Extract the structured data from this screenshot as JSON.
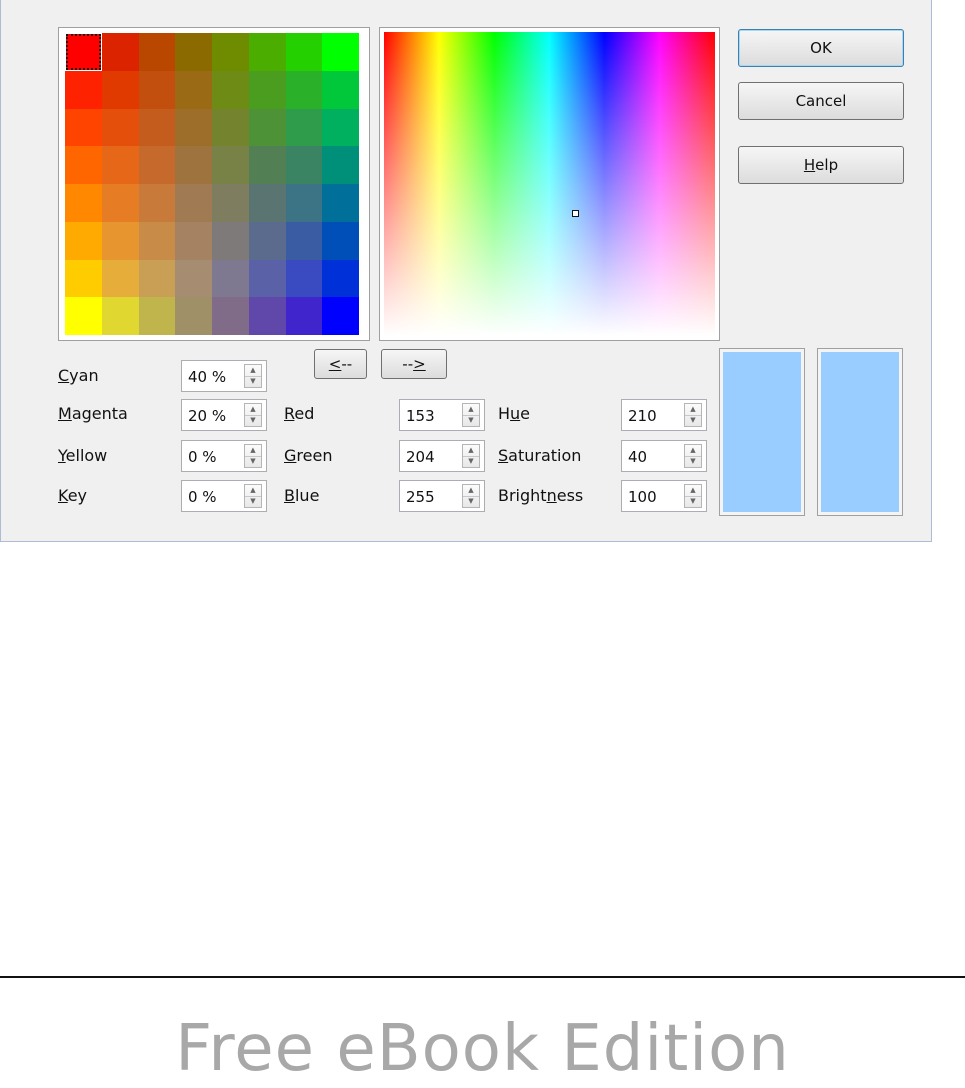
{
  "palette": {
    "rows": [
      [
        "#ff0000",
        "#dc2300",
        "#b94700",
        "#8b6b00",
        "#6f8b00",
        "#4aad00",
        "#25d000",
        "#00ff00"
      ],
      [
        "#ff2200",
        "#e03a00",
        "#c24f0e",
        "#9a6a15",
        "#6e8b16",
        "#4a9d1f",
        "#2bb02a",
        "#00c83a"
      ],
      [
        "#ff4400",
        "#e4500c",
        "#c45c1d",
        "#9c6e2a",
        "#74842e",
        "#4e9238",
        "#2e9c4a",
        "#00b05e"
      ],
      [
        "#ff6600",
        "#e66718",
        "#c6692c",
        "#9e733e",
        "#788146",
        "#537f55",
        "#3a8464",
        "#00907a"
      ],
      [
        "#ff8800",
        "#e67d24",
        "#c87a3b",
        "#a07a52",
        "#7e7d60",
        "#5a7472",
        "#3c7485",
        "#00709a"
      ],
      [
        "#ffaa00",
        "#e6952f",
        "#c98b48",
        "#a48262",
        "#7e7a7a",
        "#5a6b8e",
        "#3a5ca2",
        "#004fb8"
      ],
      [
        "#ffcc00",
        "#e6ad3a",
        "#c99e55",
        "#a68d72",
        "#7e7890",
        "#5a61a6",
        "#3a4ac0",
        "#0030d8"
      ],
      [
        "#ffff00",
        "#e0d830",
        "#c0b44d",
        "#a09068",
        "#806c88",
        "#6048aa",
        "#4024cc",
        "#0000ff"
      ]
    ]
  },
  "buttons": {
    "ok": "OK",
    "cancel": "Cancel",
    "help_pre": "",
    "help_ul": "H",
    "help_post": "elp",
    "left_ul": "<",
    "left_post": "--",
    "right_pre": "--",
    "right_ul": ">"
  },
  "cmyk": {
    "cyan": {
      "ul": "C",
      "rest": "yan",
      "value": "40 %"
    },
    "magenta": {
      "ul": "M",
      "rest": "agenta",
      "value": "20 %"
    },
    "yellow": {
      "ul": "Y",
      "rest": "ellow",
      "value": "0 %"
    },
    "key": {
      "ul": "K",
      "rest": "ey",
      "value": "0 %"
    }
  },
  "rgb": {
    "red": {
      "ul": "R",
      "rest": "ed",
      "value": "153"
    },
    "green": {
      "ul": "G",
      "rest": "reen",
      "value": "204"
    },
    "blue": {
      "ul": "B",
      "rest": "lue",
      "value": "255"
    }
  },
  "hsb": {
    "hue": {
      "pre": "H",
      "ul": "u",
      "post": "e",
      "value": "210"
    },
    "saturation": {
      "pre": "",
      "ul": "S",
      "post": "aturation",
      "value": "40"
    },
    "brightness": {
      "pre": "Bright",
      "ul": "n",
      "post": "ess",
      "value": "100"
    }
  },
  "preview": {
    "new_color": "#99ccff",
    "old_color": "#99ccff"
  },
  "footer": {
    "edition": "Free eBook Edition"
  }
}
